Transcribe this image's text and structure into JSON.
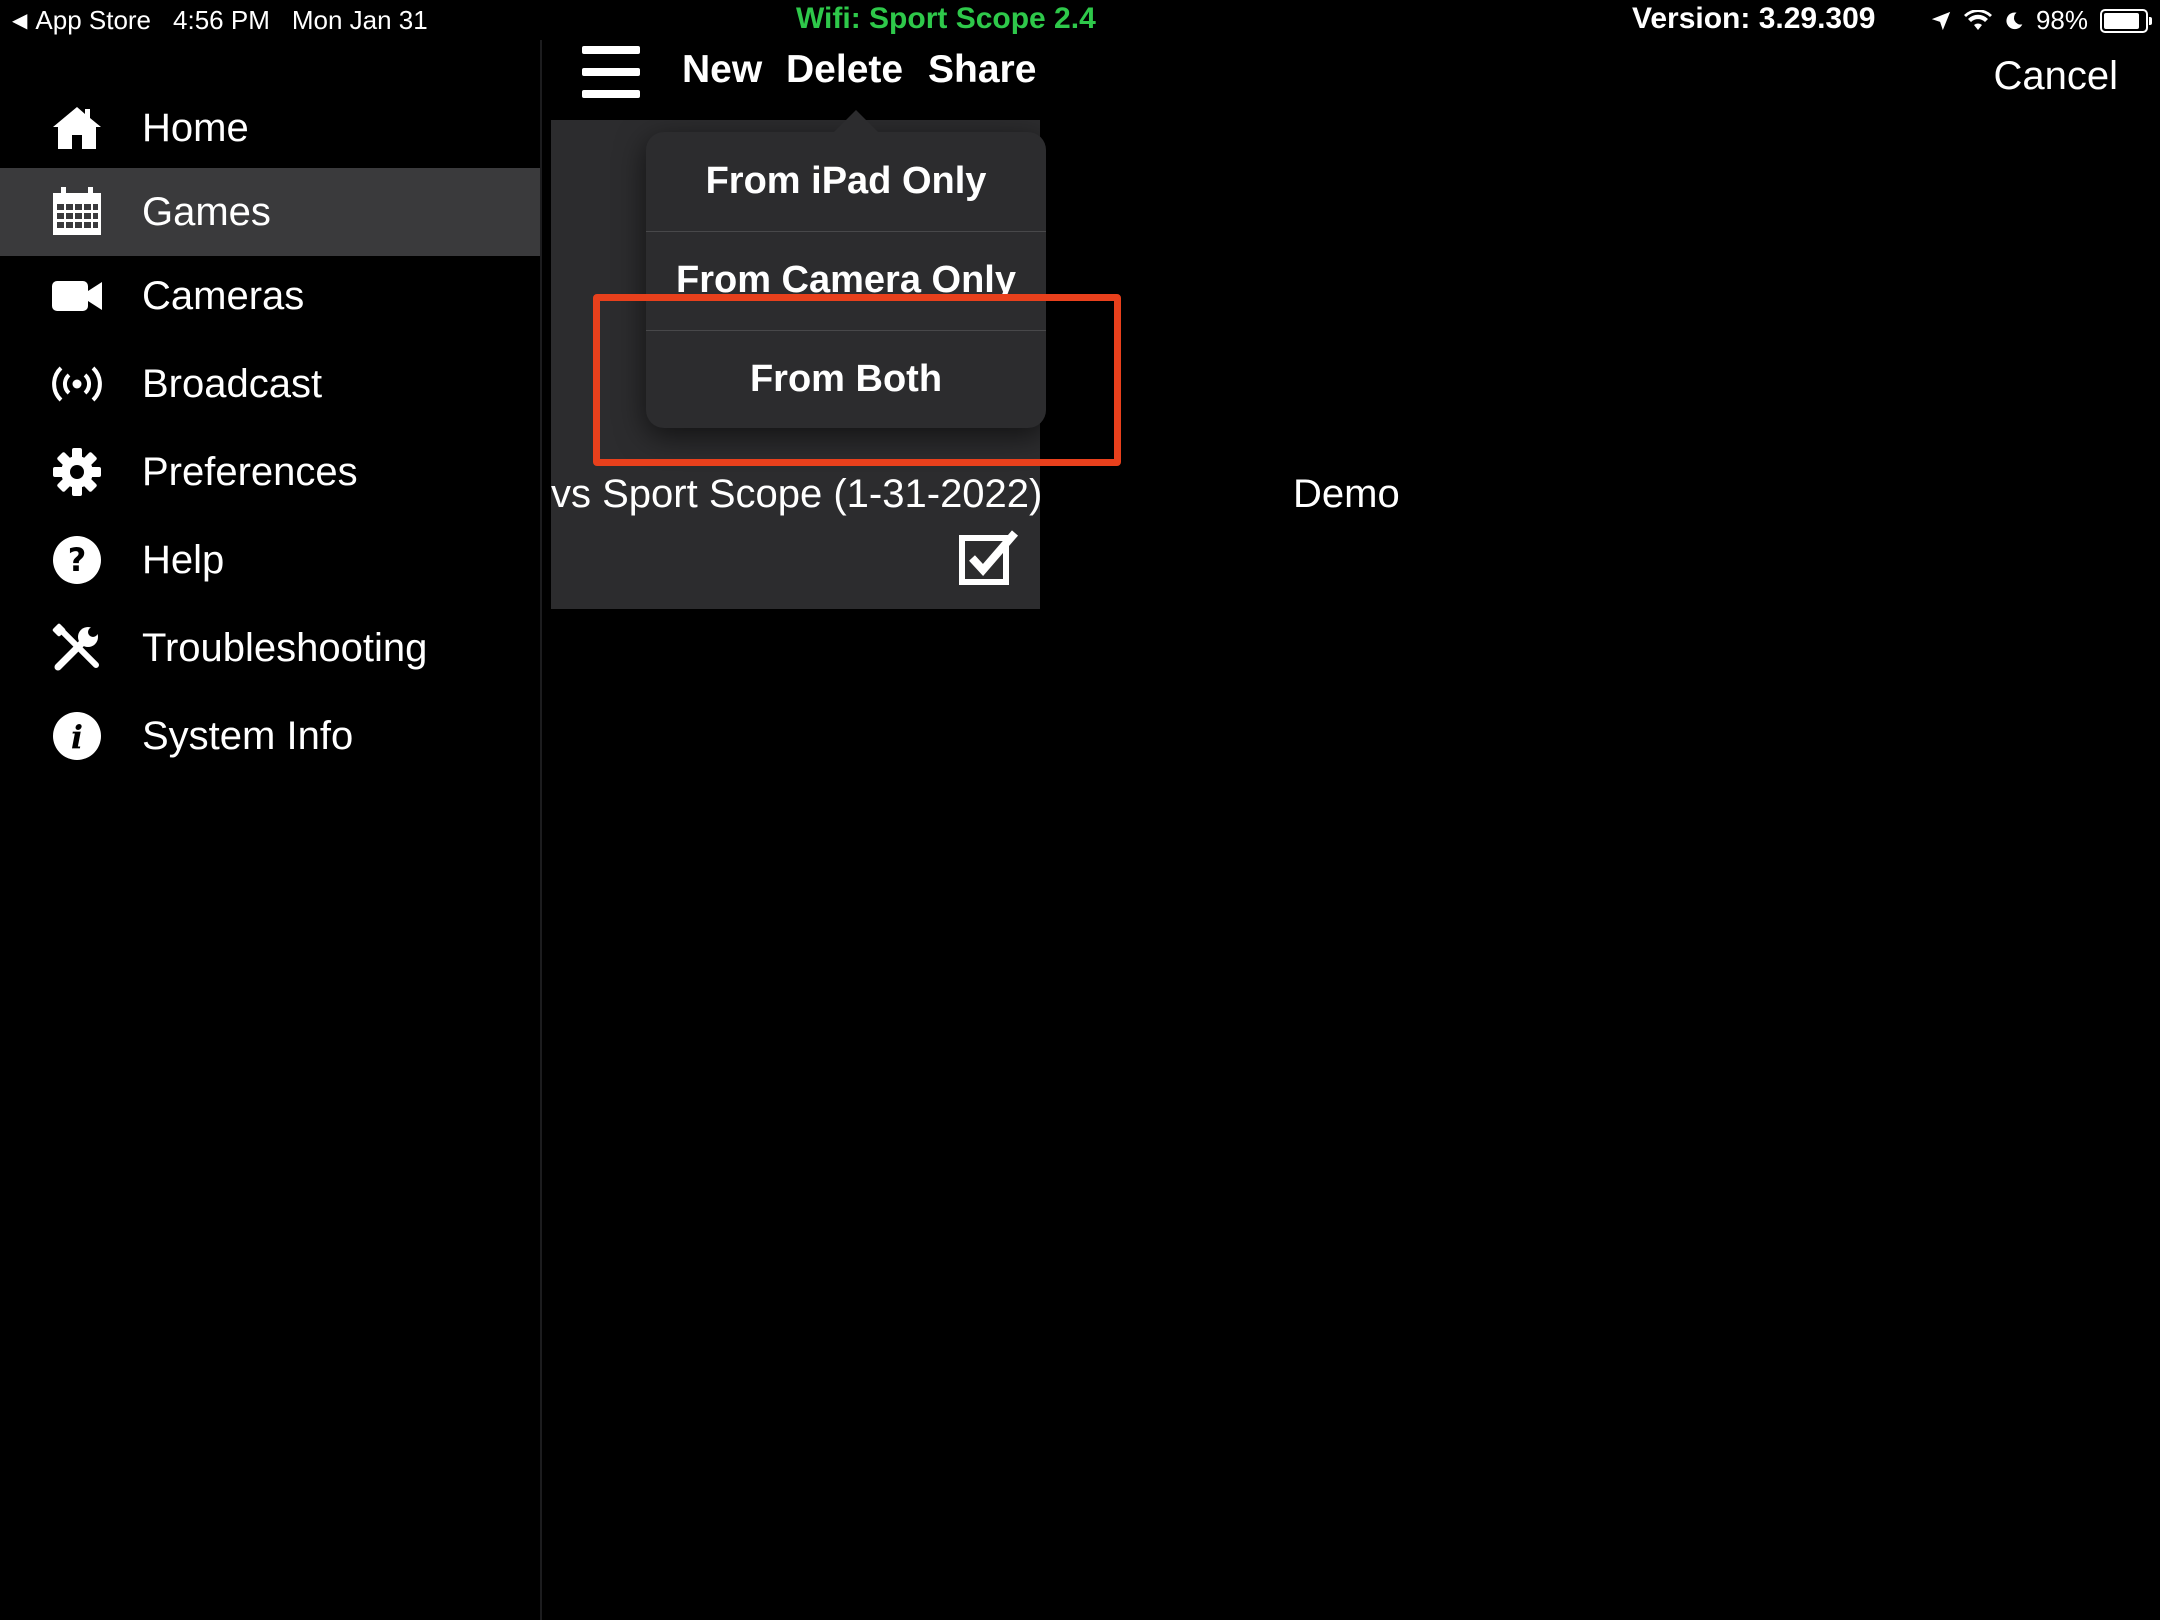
{
  "status_bar": {
    "back_app": "App Store",
    "time": "4:56 PM",
    "date": "Mon Jan 31",
    "wifi": "Wifi: Sport Scope 2.4",
    "version": "Version: 3.29.309",
    "battery": "98%",
    "battery_level": 0.98
  },
  "sidebar": {
    "items": [
      {
        "label": "Home",
        "icon": "home-icon"
      },
      {
        "label": "Games",
        "icon": "calendar-icon",
        "selected": true
      },
      {
        "label": "Cameras",
        "icon": "video-camera-icon"
      },
      {
        "label": "Broadcast",
        "icon": "broadcast-icon"
      },
      {
        "label": "Preferences",
        "icon": "gear-icon"
      },
      {
        "label": "Help",
        "icon": "question-icon"
      },
      {
        "label": "Troubleshooting",
        "icon": "tools-icon"
      },
      {
        "label": "System Info",
        "icon": "info-icon"
      }
    ]
  },
  "toolbar": {
    "new_label": "New",
    "delete_label": "Delete",
    "share_label": "Share",
    "cancel_label": "Cancel"
  },
  "game": {
    "title": "vs Sport Scope (1-31-2022)",
    "demo": "Demo"
  },
  "delete_popover": {
    "options": [
      "From iPad Only",
      "From Camera Only",
      "From Both"
    ]
  },
  "colors": {
    "wifi_green": "#2ec84a",
    "highlight": "#e8401c",
    "selected_bg": "#3a3a3c",
    "card_bg": "#2c2c2e"
  }
}
